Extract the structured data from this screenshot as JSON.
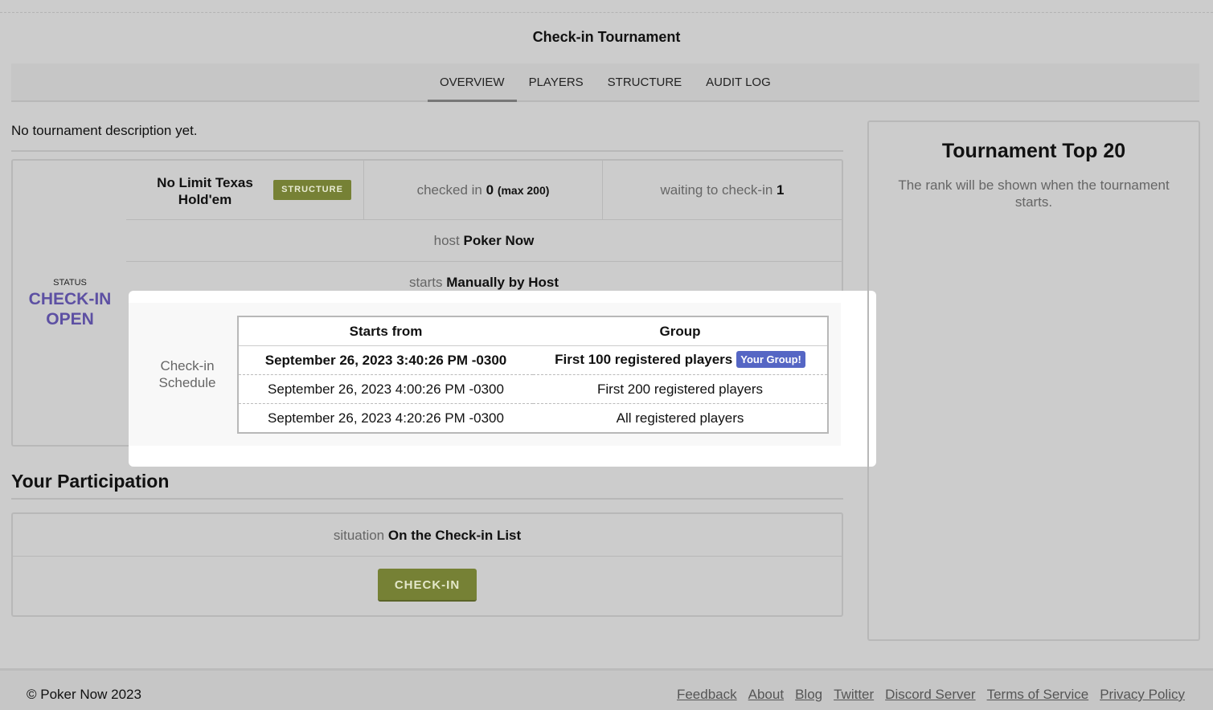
{
  "title": "Check-in Tournament",
  "tabs": [
    {
      "label": "OVERVIEW",
      "active": true
    },
    {
      "label": "PLAYERS"
    },
    {
      "label": "STRUCTURE"
    },
    {
      "label": "AUDIT LOG"
    }
  ],
  "description": "No tournament description yet.",
  "status": {
    "label": "STATUS",
    "value_line1": "CHECK-IN",
    "value_line2": "OPEN"
  },
  "game": {
    "name_line1": "No Limit Texas",
    "name_line2": "Hold'em",
    "structure_button": "STRUCTURE"
  },
  "checked_in": {
    "label": "checked in",
    "count": "0",
    "max": "(max 200)"
  },
  "waiting": {
    "label": "waiting to check-in",
    "count": "1"
  },
  "host": {
    "label": "host",
    "value": "Poker Now"
  },
  "starts": {
    "label": "starts",
    "value": "Manually by Host"
  },
  "schedule": {
    "label_line1": "Check-in",
    "label_line2": "Schedule",
    "headers": [
      "Starts from",
      "Group"
    ],
    "rows": [
      {
        "start": "September 26, 2023 3:40:26 PM -0300",
        "group": "First 100 registered players",
        "badge": "Your Group!"
      },
      {
        "start": "September 26, 2023 4:00:26 PM -0300",
        "group": "First 200 registered players"
      },
      {
        "start": "September 26, 2023 4:20:26 PM -0300",
        "group": "All registered players"
      }
    ]
  },
  "participation": {
    "title": "Your Participation",
    "situation_label": "situation",
    "situation_value": "On the Check-in List",
    "button": "CHECK-IN"
  },
  "top20": {
    "title": "Tournament Top 20",
    "text": "The rank will be shown when the tournament starts."
  },
  "footer": {
    "copyright": "© Poker Now 2023",
    "links": [
      "Feedback",
      "About",
      "Blog",
      "Twitter",
      "Discord Server",
      "Terms of Service",
      "Privacy Policy"
    ]
  },
  "colors": {
    "status_accent": "#5d50a3",
    "button_green": "#768135",
    "badge_blue": "#5566c4"
  }
}
